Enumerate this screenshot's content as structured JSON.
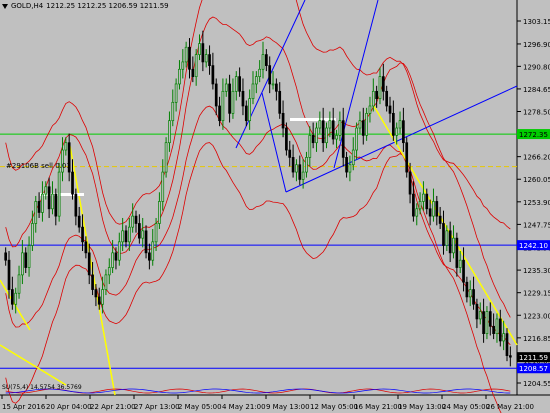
{
  "header": {
    "symbol": "GOLD,H4",
    "ohlc": "1212.25 1212.25 1206.59 1211.59"
  },
  "order": {
    "label": "#29106B sell 0.01"
  },
  "indicator": {
    "label": "SU(75,4) 14.5754 36.5769"
  },
  "price_axis": {
    "ticks": [
      "1303.15",
      "1296.90",
      "1290.80",
      "1284.65",
      "1278.50",
      "1272.35",
      "1266.20",
      "1260.05",
      "1253.90",
      "1247.75",
      "1241.50",
      "1235.30",
      "1229.15",
      "1223.00",
      "1216.85",
      "1210.65",
      "1204.55"
    ],
    "tag_green": "1272.35",
    "tag_blue": "1242.10",
    "tag_price": "1211.59",
    "tag_blue_low": "1208.57"
  },
  "time_axis": {
    "labels": [
      "15 Apr 2016",
      "20 Apr 04:00",
      "22 Apr 21:00",
      "27 Apr 13:00",
      "2 May 05:00",
      "4 May 21:00",
      "9 May 13:00",
      "12 May 05:00",
      "16 May 21:00",
      "19 May 13:00",
      "24 May 05:00",
      "26 May 21:00"
    ]
  },
  "colors": {
    "background": "#c0c0c0",
    "bull": "#008000",
    "bear": "#000000",
    "band": "#dd0000",
    "trend_blue": "#0000ff",
    "trend_yellow": "#ffff00",
    "green_level": "#00cc00"
  },
  "chart_data": {
    "type": "candlestick",
    "ylim": [
      1204.55,
      1303.15
    ],
    "levels": [
      {
        "name": "green",
        "value": 1272.35
      },
      {
        "name": "blue",
        "value": 1242.1
      },
      {
        "name": "blue-low",
        "value": 1208.57
      }
    ],
    "closes": [
      1238,
      1230,
      1226,
      1229,
      1234,
      1240,
      1236,
      1242,
      1248,
      1254,
      1251,
      1256,
      1258,
      1252,
      1256,
      1250,
      1262,
      1268,
      1270,
      1262,
      1256,
      1250,
      1247,
      1243,
      1240,
      1234,
      1230,
      1228,
      1226,
      1230,
      1234,
      1236,
      1240,
      1238,
      1243,
      1246,
      1243,
      1247,
      1250,
      1248,
      1244,
      1246,
      1240,
      1238,
      1243,
      1248,
      1254,
      1262,
      1270,
      1276,
      1281,
      1286,
      1290,
      1292,
      1296,
      1290,
      1288,
      1294,
      1297,
      1292,
      1294,
      1291,
      1286,
      1280,
      1276,
      1284,
      1286,
      1278,
      1284,
      1288,
      1284,
      1280,
      1276,
      1282,
      1286,
      1288,
      1290,
      1294,
      1291,
      1286,
      1286,
      1284,
      1278,
      1274,
      1268,
      1266,
      1262,
      1264,
      1260,
      1262,
      1266,
      1272,
      1270,
      1274,
      1276,
      1270,
      1274,
      1276,
      1271,
      1272,
      1276,
      1266,
      1262,
      1264,
      1268,
      1274,
      1276,
      1272,
      1278,
      1280,
      1284,
      1282,
      1288,
      1284,
      1280,
      1278,
      1272,
      1274,
      1276,
      1270,
      1262,
      1256,
      1250,
      1252,
      1254,
      1256,
      1252,
      1250,
      1254,
      1250,
      1248,
      1242,
      1246,
      1240,
      1244,
      1236,
      1238,
      1232,
      1228,
      1230,
      1226,
      1222,
      1224,
      1218,
      1224,
      1220,
      1218,
      1222,
      1216,
      1218,
      1212,
      1211.59
    ]
  }
}
